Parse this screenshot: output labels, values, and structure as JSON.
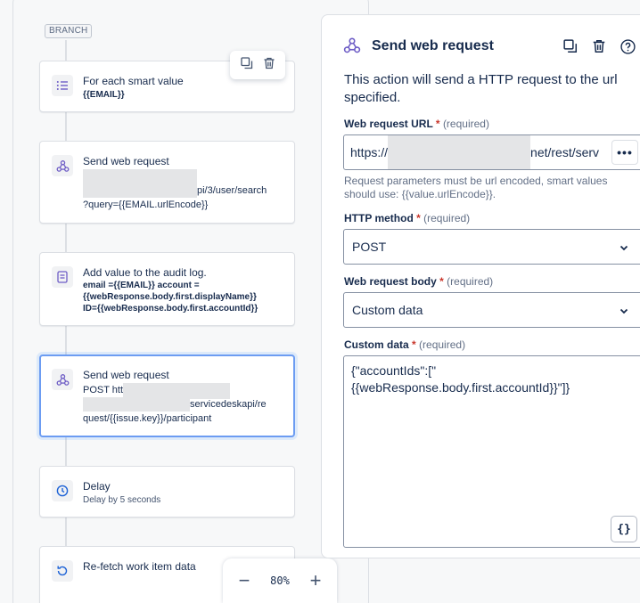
{
  "canvas": {
    "branch_label": "BRANCH",
    "nodes": [
      {
        "title": "For each smart value",
        "sub": "{{EMAIL}}"
      },
      {
        "title": "Send web request",
        "line1_tail": "pi/3/user/search",
        "line2": "?query={{EMAIL.urlEncode}}"
      },
      {
        "title": "Add value to the audit log.",
        "lines": [
          "email ={{EMAIL}} account =",
          "{{webResponse.body.first.displayName}}",
          "ID={{webResponse.body.first.accountId}}"
        ]
      },
      {
        "title": "Send web request",
        "line1": "POST htt",
        "line2_tail": "servicedeskapi/re",
        "line3": "quest/{{issue.key}}/participant"
      },
      {
        "title": "Delay",
        "sub": "Delay by 5 seconds"
      },
      {
        "title": "Re-fetch work item data"
      }
    ],
    "zoom": {
      "value": "80%",
      "minus": "−",
      "plus": "+"
    }
  },
  "panel": {
    "title": "Send web request",
    "description": "This action will send a HTTP request to the url specified.",
    "url_label": "Web request URL",
    "required_text": "(required)",
    "url_prefix": "https://",
    "url_suffix": "net/rest/serv",
    "url_more": "•••",
    "url_helper": "Request parameters must be url encoded, smart values should use: {{value.urlEncode}}.",
    "method_label": "HTTP method",
    "method_value": "POST",
    "body_label": "Web request body",
    "body_value": "Custom data",
    "custom_label": "Custom data",
    "custom_value": "{\"accountIds\":[\"\n{{webResponse.body.first.accountId}}\"]}",
    "brace_button": "{}"
  },
  "colors": {
    "accent": "#6c9cf2",
    "required": "#c9372c",
    "purple_icon": "#6e5dc6"
  }
}
